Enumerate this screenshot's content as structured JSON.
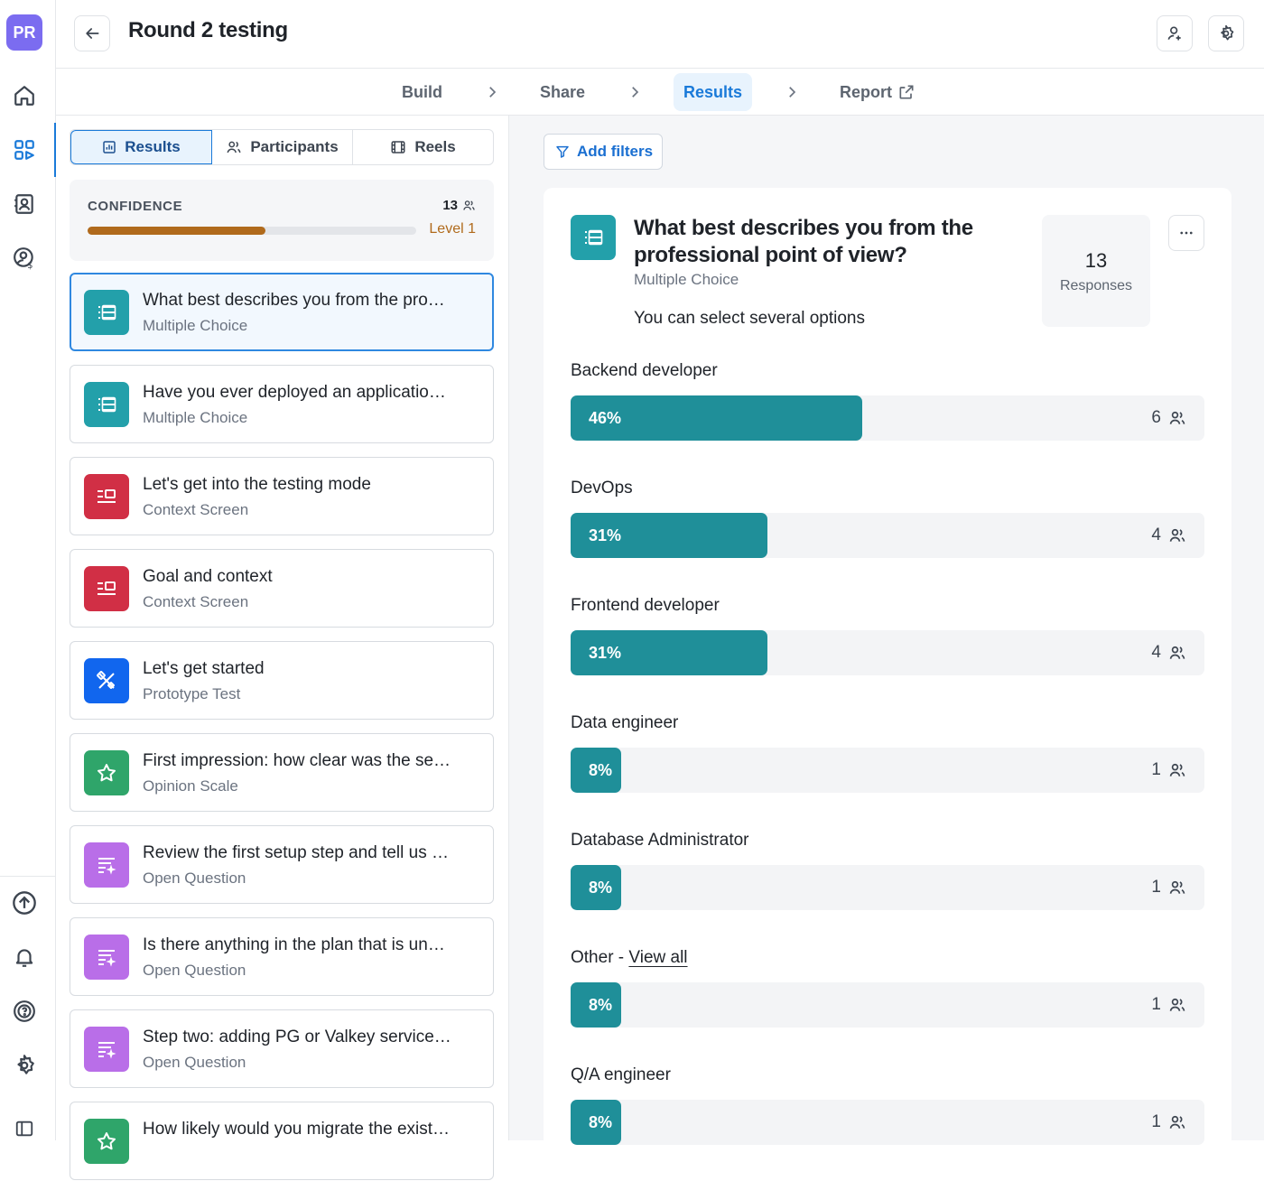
{
  "app": {
    "avatar": "PR",
    "title": "Round 2 testing"
  },
  "steps": [
    {
      "label": "Build"
    },
    {
      "label": "Share"
    },
    {
      "label": "Results"
    },
    {
      "label": "Report"
    }
  ],
  "tabs": [
    {
      "label": "Results"
    },
    {
      "label": "Participants"
    },
    {
      "label": "Reels"
    }
  ],
  "confidence": {
    "label": "CONFIDENCE",
    "count": "13",
    "level": "Level 1",
    "progress_percent": 54,
    "color": "#b06a1c"
  },
  "questions": [
    {
      "title": "What best describes you from the pro…",
      "type": "Multiple Choice",
      "icon": "list-icon",
      "color": "#23a0aa"
    },
    {
      "title": "Have you ever deployed an applicatio…",
      "type": "Multiple Choice",
      "icon": "list-icon",
      "color": "#23a0aa"
    },
    {
      "title": "Let's get into the testing mode",
      "type": "Context Screen",
      "icon": "context-screen-icon",
      "color": "#d12f45"
    },
    {
      "title": "Goal and context",
      "type": "Context Screen",
      "icon": "context-screen-icon",
      "color": "#d12f45"
    },
    {
      "title": "Let's get started",
      "type": "Prototype Test",
      "icon": "prototype-icon",
      "color": "#1166ee"
    },
    {
      "title": "First impression: how clear was the se…",
      "type": "Opinion Scale",
      "icon": "star-icon",
      "color": "#2fa56a"
    },
    {
      "title": "Review the first setup step and tell us …",
      "type": "Open Question",
      "icon": "open-question-icon",
      "color": "#b96ee8"
    },
    {
      "title": "Is there anything in the plan that is un…",
      "type": "Open Question",
      "icon": "open-question-icon",
      "color": "#b96ee8"
    },
    {
      "title": "Step two: adding PG or Valkey service…",
      "type": "Open Question",
      "icon": "open-question-icon",
      "color": "#b96ee8"
    },
    {
      "title": "How likely would you migrate the exist…",
      "type": "",
      "icon": "star-icon",
      "color": "#2fa56a"
    }
  ],
  "filters": {
    "label": "Add filters"
  },
  "detail": {
    "title": "What best describes you from the professional point of view?",
    "type": "Multiple Choice",
    "note": "You can select several options",
    "responses_count": "13",
    "responses_label": "Responses",
    "bar_color": "#1f8f99"
  },
  "options": [
    {
      "label": "Backend developer",
      "percent": "46%",
      "value": 46,
      "votes": "6"
    },
    {
      "label": "DevOps",
      "percent": "31%",
      "value": 31,
      "votes": "4"
    },
    {
      "label": "Frontend developer",
      "percent": "31%",
      "value": 31,
      "votes": "4"
    },
    {
      "label": "Data engineer",
      "percent": "8%",
      "value": 8,
      "votes": "1"
    },
    {
      "label": "Database Administrator",
      "percent": "8%",
      "value": 8,
      "votes": "1"
    },
    {
      "label": "Other - ",
      "link": "View all",
      "percent": "8%",
      "value": 8,
      "votes": "1"
    },
    {
      "label": "Q/A engineer",
      "percent": "8%",
      "value": 8,
      "votes": "1"
    }
  ]
}
